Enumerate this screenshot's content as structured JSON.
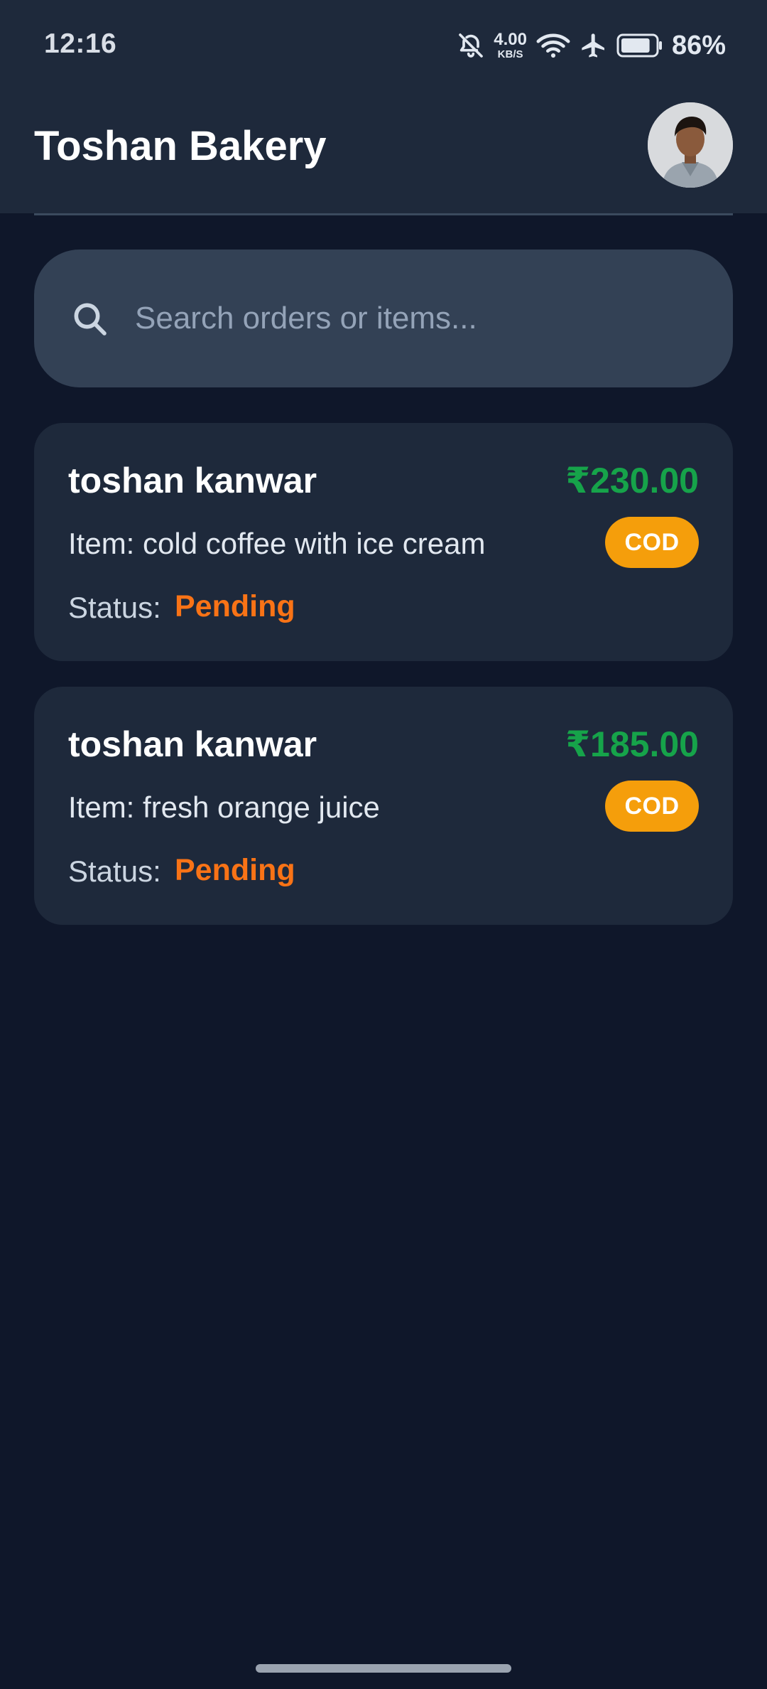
{
  "status_bar": {
    "time": "12:16",
    "net_speed_value": "4.00",
    "net_speed_unit": "KB/S",
    "battery_percent": "86%",
    "icons": [
      "bell-off-icon",
      "wifi-icon",
      "airplane-icon",
      "battery-icon"
    ],
    "battery_level": 0.86
  },
  "app_bar": {
    "title": "Toshan Bakery",
    "avatar_icon": "user-avatar"
  },
  "search": {
    "placeholder": "Search orders or items...",
    "value": "",
    "icon": "search-icon"
  },
  "orders": [
    {
      "customer": "toshan kanwar",
      "price": "₹230.00",
      "item": "Item: cold coffee with ice cream",
      "payment": "COD",
      "status_label": "Status:",
      "status": "Pending"
    },
    {
      "customer": "toshan kanwar",
      "price": "₹185.00",
      "item": "Item: fresh orange juice",
      "payment": "COD",
      "status_label": "Status:",
      "status": "Pending"
    }
  ],
  "colors": {
    "background": "#0f172a",
    "surface": "#1e293b",
    "search_bg": "#334155",
    "price": "#16a34a",
    "badge": "#f59e0b",
    "status_pending": "#f97316"
  }
}
